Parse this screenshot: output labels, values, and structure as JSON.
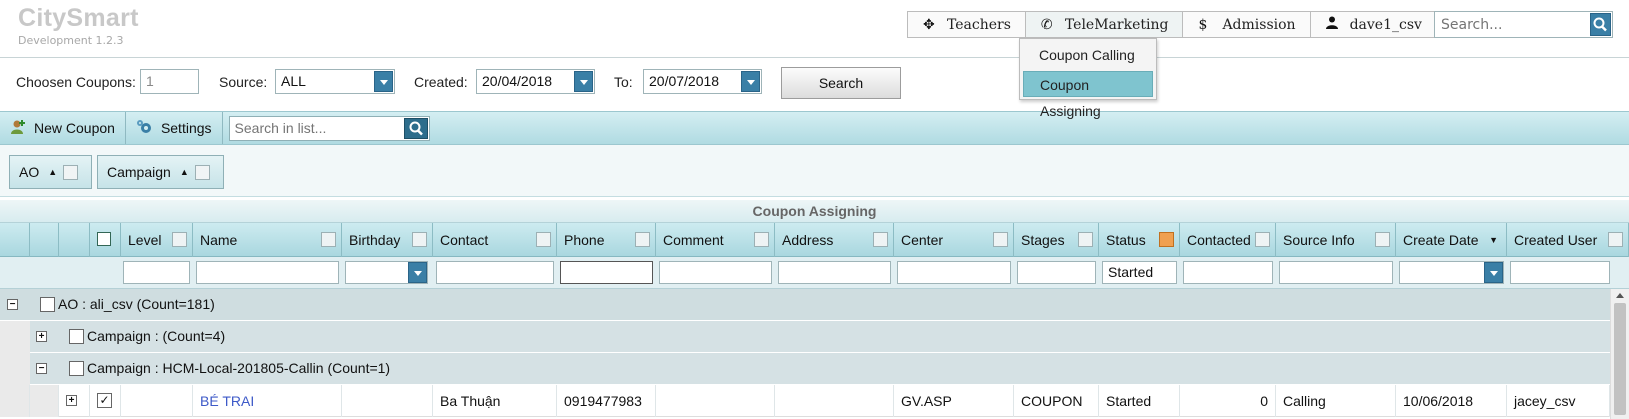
{
  "app": {
    "name": "CitySmart",
    "version": "Development 1.2.3"
  },
  "topnav": [
    {
      "label": "Teachers",
      "icon": "move-icon",
      "glyph": "✥"
    },
    {
      "label": "TeleMarketing",
      "icon": "phone-icon",
      "glyph": "✆"
    },
    {
      "label": "Admission",
      "icon": "dollar-icon",
      "glyph": "$"
    },
    {
      "label": "dave1_csv",
      "icon": "user-icon",
      "glyph": "👤"
    }
  ],
  "top_search": {
    "placeholder": "Search..."
  },
  "dropdown": {
    "items": [
      {
        "label": "Coupon Calling"
      },
      {
        "label": "Coupon Assigning"
      }
    ],
    "active": "Coupon Assigning"
  },
  "filters": {
    "chosen_label": "Choosen Coupons:",
    "chosen_value": "1",
    "source_label": "Source:",
    "source_value": "ALL",
    "created_label": "Created:",
    "created_value": "20/04/2018",
    "to_label": "To:",
    "to_value": "20/07/2018",
    "search_button": "Search"
  },
  "toolbar": {
    "new_coupon": "New Coupon",
    "settings": "Settings",
    "search_placeholder": "Search in list..."
  },
  "group_chips": [
    {
      "label": "AO"
    },
    {
      "label": "Campaign"
    }
  ],
  "grid": {
    "title": "Coupon Assigning",
    "columns": [
      "Level",
      "Name",
      "Birthday",
      "Contact",
      "Phone",
      "Comment",
      "Address",
      "Center",
      "Stages",
      "Status",
      "Contacted",
      "Source Info",
      "Create Date",
      "Created User"
    ],
    "status_filter": "Started",
    "groups": [
      {
        "text": "AO : ali_csv (Count=181)",
        "state": "expanded"
      },
      {
        "text": "Campaign : (Count=4)",
        "state": "collapsed"
      },
      {
        "text": "Campaign : HCM-Local-201805-Callin (Count=1)",
        "state": "expanded"
      }
    ],
    "rows": [
      {
        "level": "",
        "name": "BÉ TRAI",
        "birthday": "",
        "contact": "Ba Thuận",
        "phone": "0919477983",
        "comment": "",
        "address": "",
        "center": "GV.ASP",
        "stages": "COUPON",
        "status": "Started",
        "contacted": "0",
        "source_info": "Calling",
        "create_date": "10/06/2018",
        "created_user": "jacey_csv",
        "checked": true
      }
    ]
  },
  "colors": {
    "accent": "#3a7fa6",
    "header": "#b6dde4",
    "highlight": "#7fc4cf",
    "link": "#3e5ac8"
  }
}
